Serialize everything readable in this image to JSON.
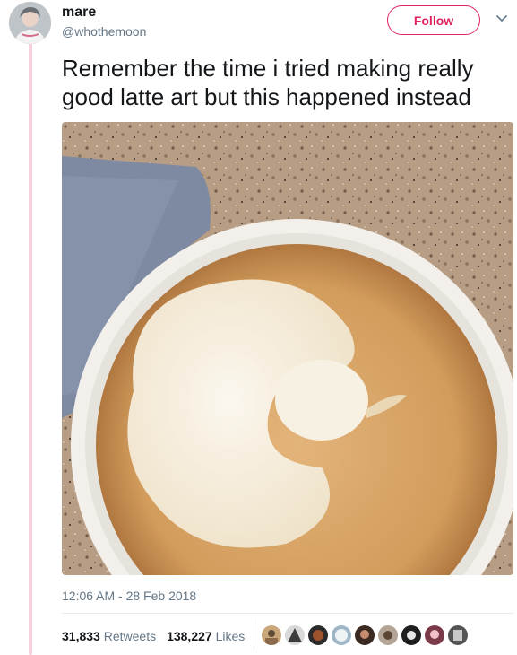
{
  "author": {
    "display_name": "mare",
    "handle": "@whothemoon"
  },
  "actions": {
    "follow_label": "Follow",
    "menu_icon": "chevron-down-icon"
  },
  "tweet": {
    "text": "Remember the time i tried making really good latte art but this happened instead",
    "media_icon": "latte-photo",
    "timestamp": "12:06 AM - 28 Feb 2018"
  },
  "stats": {
    "retweets_count": "31,833",
    "retweets_label": "Retweets",
    "likes_count": "138,227",
    "likes_label": "Likes"
  },
  "colors": {
    "accent": "#e0245e",
    "thread_line": "#f6cfdc",
    "muted_text": "#657786",
    "text": "#14171a"
  }
}
